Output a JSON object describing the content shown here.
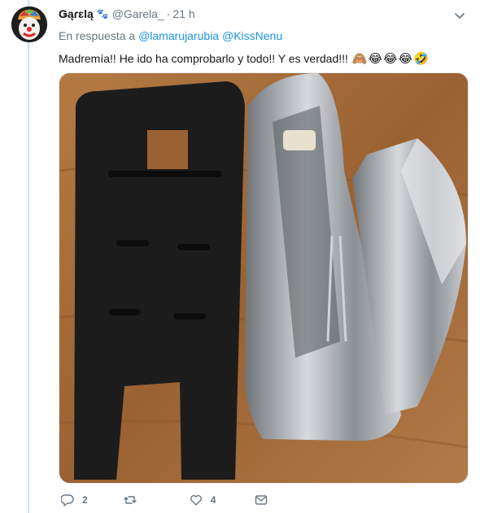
{
  "author": {
    "display_name": "Ǥąɾɛlą",
    "name_emoji": "🐾",
    "handle": "@Garela_",
    "separator": "·",
    "time": "21 h",
    "avatar_icon": "clown-avatar"
  },
  "reply": {
    "prefix": "En respuesta a",
    "mentions": [
      "@lamarujarubia",
      "@KissNenu"
    ]
  },
  "tweet": {
    "text": "Madremía!! He ido ha comprobarlo y todo!! Y es verdad!!!",
    "emojis": [
      "🙈",
      "😂",
      "😂",
      "😂",
      "🤣"
    ],
    "media_icon": "photo-open-stapler-on-wooden-table"
  },
  "actions": {
    "reply_count": "2",
    "retweet_count": "",
    "like_count": "4"
  },
  "colors": {
    "link": "#1b95e0",
    "secondary_text": "#657786",
    "thread_line": "#c4e2f5"
  }
}
